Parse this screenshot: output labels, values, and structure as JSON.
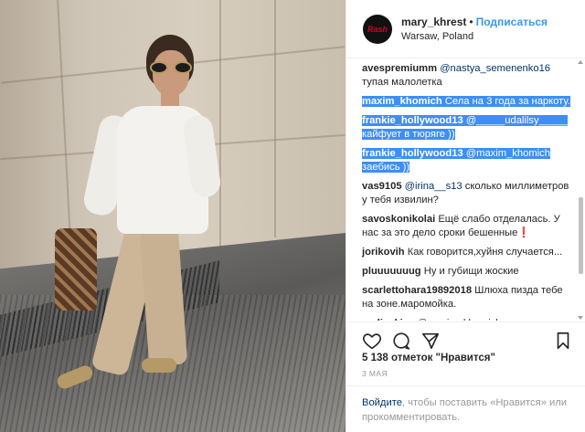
{
  "header": {
    "username": "mary_khrest",
    "separator": "•",
    "follow_label": "Подписаться",
    "location": "Warsaw, Poland",
    "avatar_text": "Rash"
  },
  "comments": [
    {
      "user": "avespremiumm",
      "mention": "@nastya_semenenko16",
      "text": "тупая малолетка",
      "selected": false
    },
    {
      "user": "maxim_khomich",
      "mention": "",
      "text": "Села на 3 года за наркоту.",
      "selected": true
    },
    {
      "user": "frankie_hollywood13",
      "mention": "@_____udalilsy_____",
      "text": "кайфует в тюряге ))",
      "selected": true
    },
    {
      "user": "frankie_hollywood13",
      "mention": "@maxim_khomich",
      "text": "заебись ))",
      "selected": true
    },
    {
      "user": "vas9105",
      "mention": "@irina__s13",
      "text": "сколько миллиметров у тебя извилин?",
      "selected": false
    },
    {
      "user": "savoskonikolai",
      "mention": "",
      "text": "Ещё слабо отделалась. У нас за это дело сроки бешенные❗",
      "selected": false
    },
    {
      "user": "jorikovih",
      "mention": "",
      "text": "Как говорится,хуйня случается...",
      "selected": false
    },
    {
      "user": "pluuuuuuug",
      "mention": "",
      "text": "Ну и губищи жоские",
      "selected": false
    },
    {
      "user": "scarlettohara19892018",
      "mention": "",
      "text": "Шлюха пизда тебе на зоне.маромойка.",
      "selected": false
    },
    {
      "user": "nadia_kisa",
      "mention": "@maxim_khomich",
      "text": "от куда",
      "selected": false
    }
  ],
  "actions": {
    "like_icon": "heart-icon",
    "comment_icon": "comment-icon",
    "share_icon": "share-icon",
    "save_icon": "bookmark-icon"
  },
  "likes_text": "5 138 отметок \"Нравится\"",
  "date_text": "3 МАЯ",
  "login": {
    "link_label": "Войдите",
    "rest_text": ", чтобы поставить «Нравится» или прокомментировать."
  },
  "colors": {
    "accent": "#3897f0",
    "selection": "#3d8ff5",
    "mention": "#003569",
    "muted": "#999999"
  }
}
